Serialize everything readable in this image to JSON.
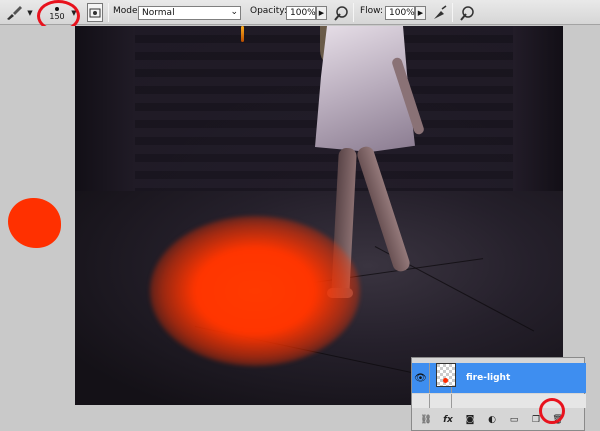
{
  "options_bar": {
    "brush_size": "150",
    "mode_label": "Mode:",
    "mode_value": "Normal",
    "opacity_label": "Opacity:",
    "opacity_value": "100%",
    "flow_label": "Flow:",
    "flow_value": "100%",
    "icons": [
      "brush-tool-icon",
      "brush-preset-icon",
      "brush-panel-toggle-icon",
      "airbrush-icon",
      "tablet-pressure-icon"
    ]
  },
  "layers_panel": {
    "active_layer_name": "fire-light",
    "footer_icons": [
      "link-icon",
      "fx-icon",
      "mask-icon",
      "adjustment-icon",
      "group-icon",
      "new-layer-icon",
      "trash-icon"
    ]
  },
  "colors": {
    "fire": "#ff3000",
    "highlight_circle": "#e8121d",
    "selected_layer": "#3e8ef0"
  }
}
